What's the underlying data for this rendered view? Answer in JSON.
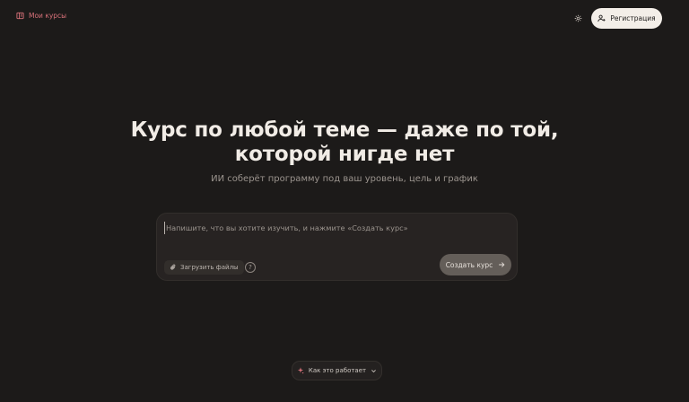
{
  "header": {
    "my_courses_label": "Мои курсы",
    "my_courses_icon": "book-icon",
    "settings_icon": "gear-icon",
    "register_label": "Регистрация",
    "register_icon": "user-plus-icon"
  },
  "hero": {
    "title_line1": "Курс по любой теме — даже по той,",
    "title_line2": "которой нигде нет",
    "subtitle": "ИИ соберёт программу под ваш уровень, цель и график"
  },
  "composer": {
    "placeholder": "Напишите, что вы хотите изучить, и нажмите «Создать курс»",
    "upload_label": "Загрузить файлы",
    "upload_icon": "paperclip-icon",
    "help_symbol": "?",
    "create_label": "Создать курс",
    "create_icon": "arrow-right-icon"
  },
  "footer": {
    "how_label": "Как это работает",
    "how_icon": "sparkle-icon",
    "chevron_icon": "chevron-down-icon"
  },
  "colors": {
    "background": "#1c1a19",
    "accent": "#d9727a",
    "composer_bg": "#272322",
    "create_button_bg": "#645e59",
    "register_button_bg": "#f3eee8"
  }
}
